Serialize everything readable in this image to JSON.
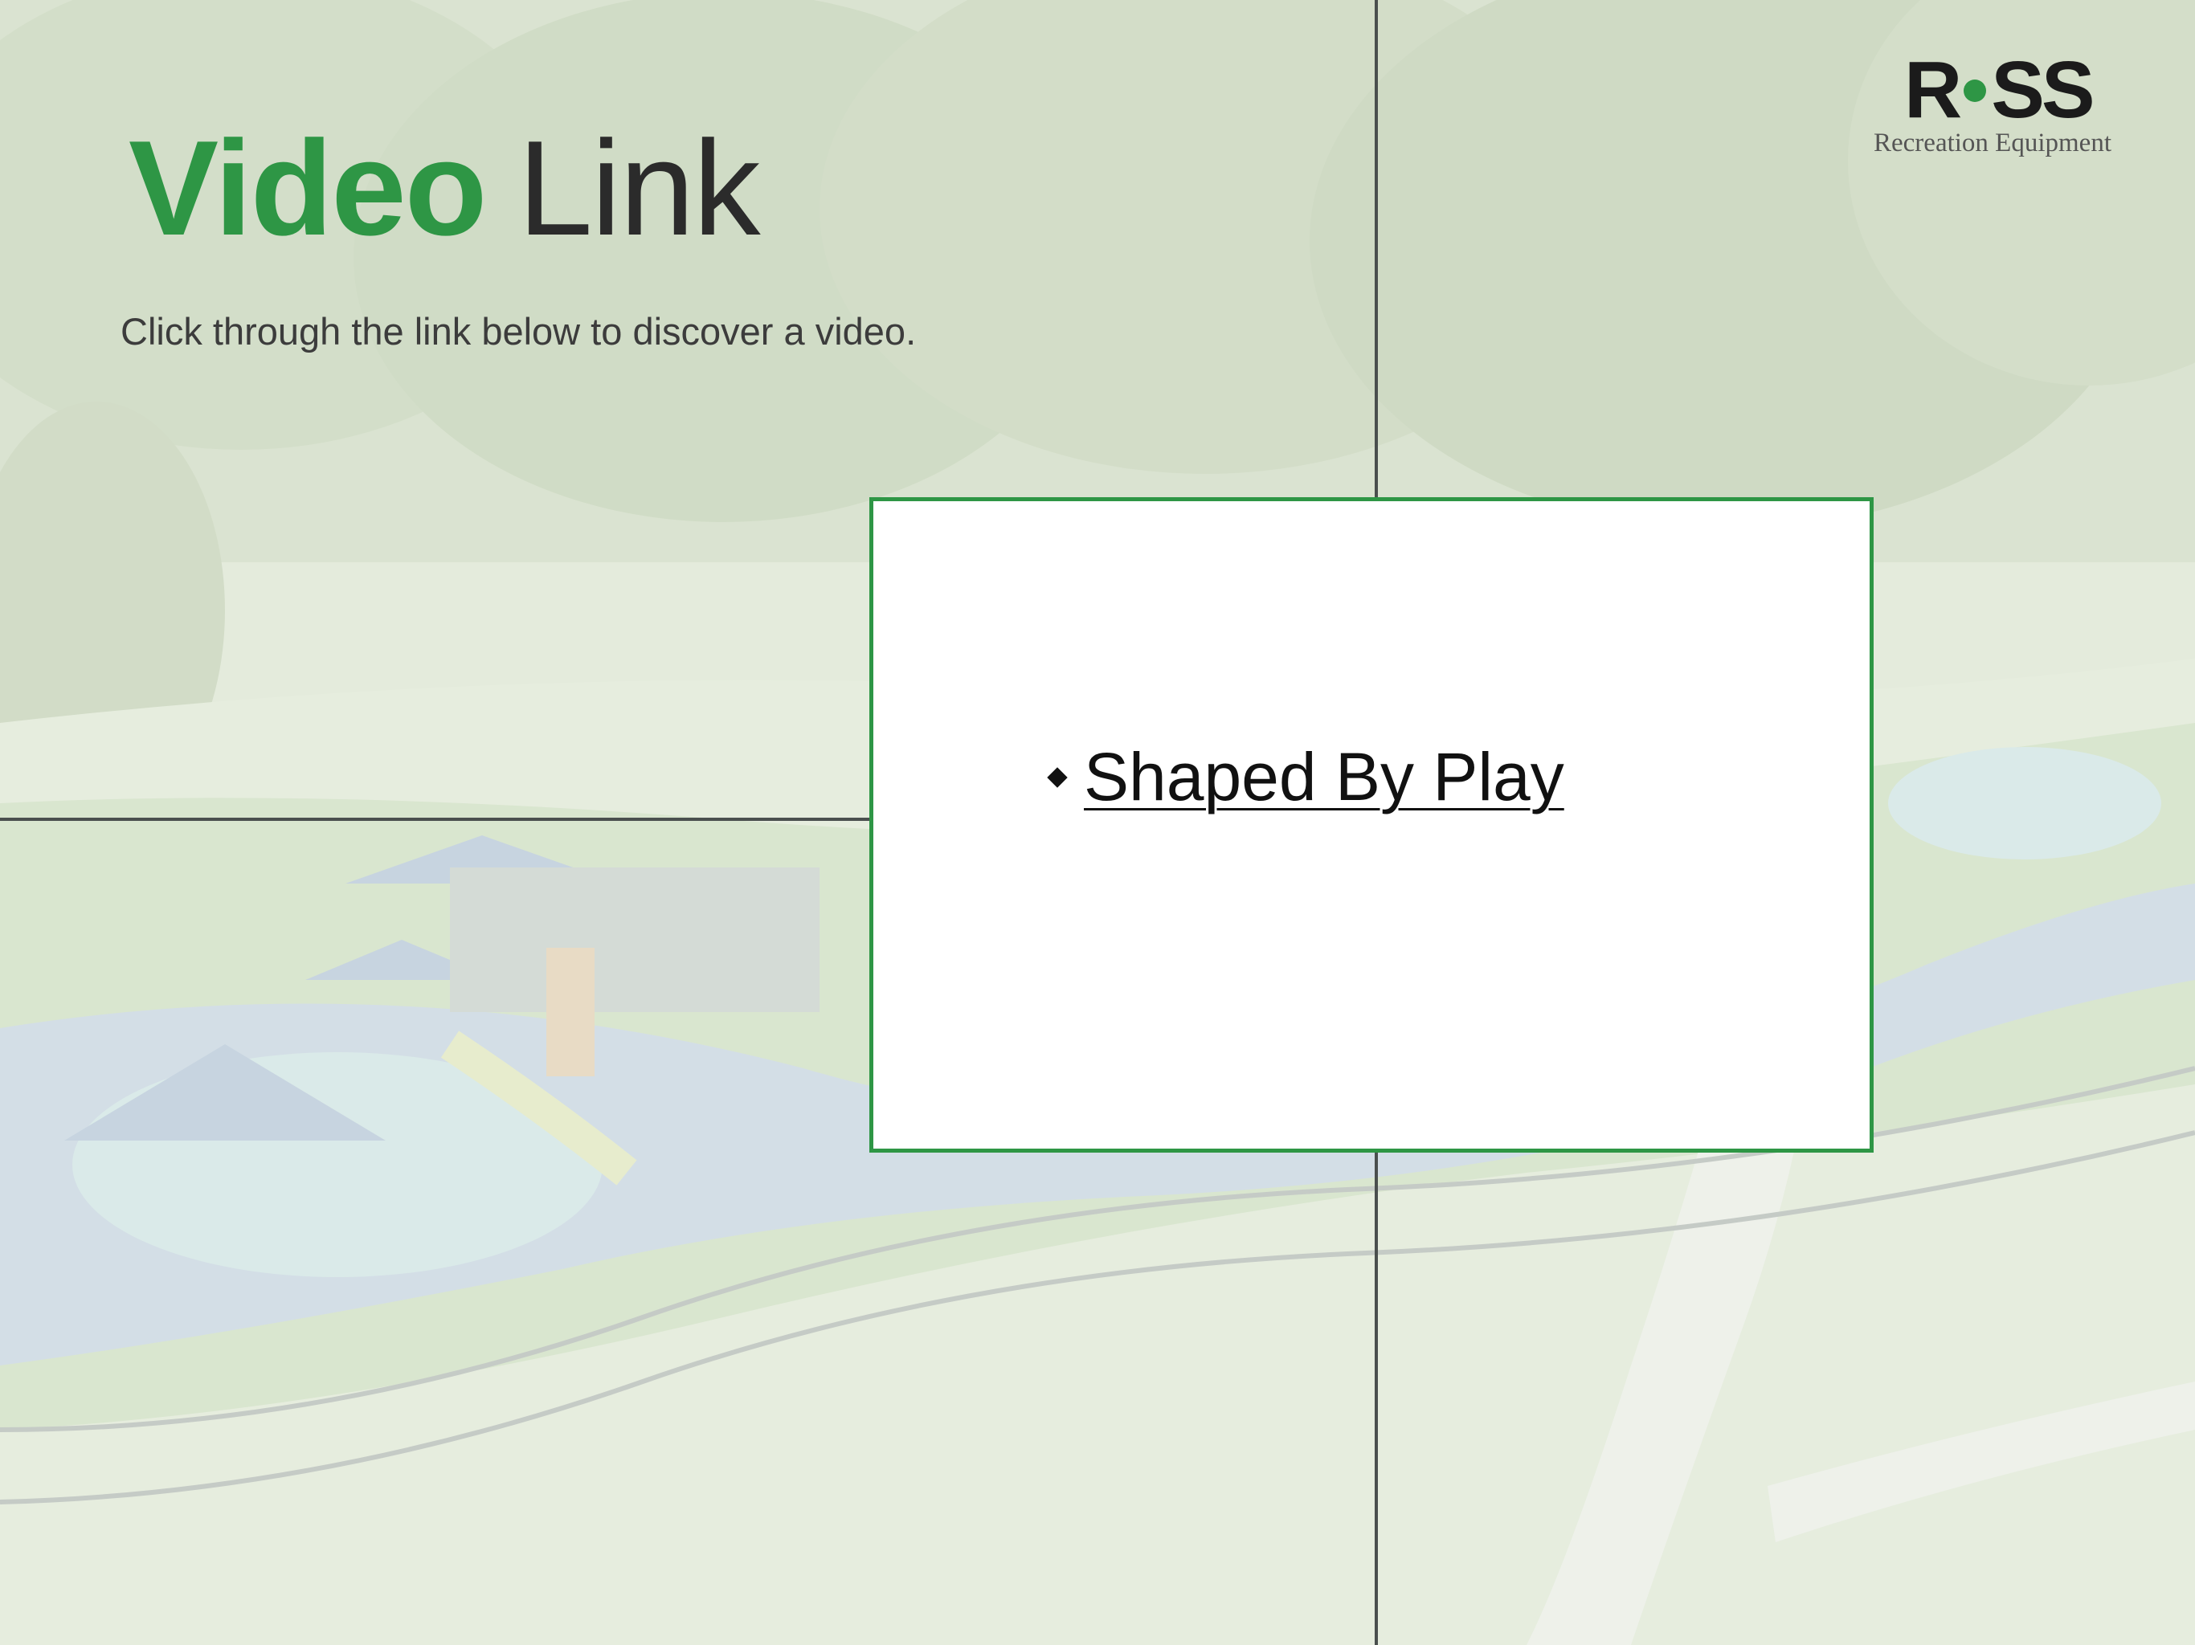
{
  "slide": {
    "title_bold": "Video",
    "title_light": "Link",
    "subtitle": "Click through the link below to discover a video."
  },
  "logo": {
    "mark_left": "R",
    "mark_right": "SS",
    "tagline": "Recreation Equipment"
  },
  "link_card": {
    "bullet_icon": "diamond-bullet-icon",
    "link_text": "Shaped By Play"
  },
  "colors": {
    "accent_green": "#2e9645",
    "divider": "#4a4f4e",
    "text_dark": "#2b2b2b"
  }
}
